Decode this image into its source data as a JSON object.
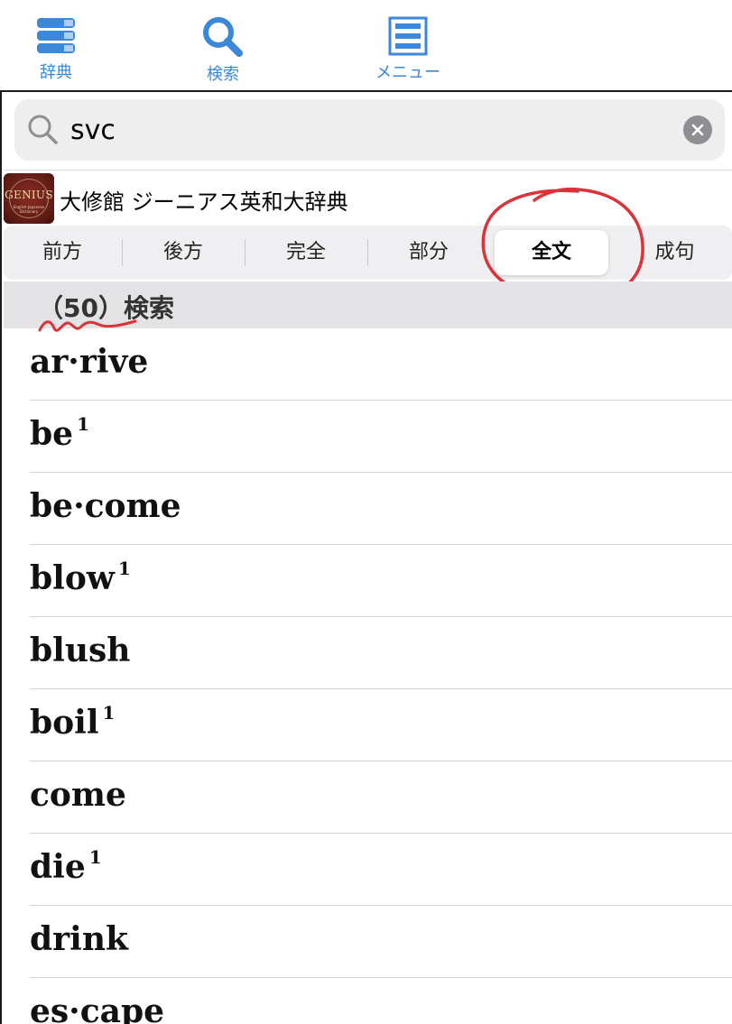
{
  "toolbar": {
    "dict_label": "辞典",
    "search_label": "検索",
    "menu_label": "メニュー"
  },
  "search": {
    "value": "svc"
  },
  "dictionary": {
    "name": "大修館 ジーニアス英和大辞典",
    "logo_text": "GENIUS",
    "logo_sub": "English-Japanese Dictionary"
  },
  "tabs": [
    {
      "label": "前方"
    },
    {
      "label": "後方"
    },
    {
      "label": "完全"
    },
    {
      "label": "部分"
    },
    {
      "label": "全文",
      "selected": true
    },
    {
      "label": "成句"
    }
  ],
  "results": {
    "count_label": "（50）検索",
    "items": [
      {
        "word": "ar·rive",
        "sup": ""
      },
      {
        "word": "be",
        "sup": "1"
      },
      {
        "word": "be·come",
        "sup": ""
      },
      {
        "word": "blow",
        "sup": "1"
      },
      {
        "word": "blush",
        "sup": ""
      },
      {
        "word": "boil",
        "sup": "1"
      },
      {
        "word": "come",
        "sup": ""
      },
      {
        "word": "die",
        "sup": "1"
      },
      {
        "word": "drink",
        "sup": ""
      },
      {
        "word": "es·cape",
        "sup": ""
      }
    ]
  },
  "colors": {
    "accent": "#3b87d9",
    "annotation": "#d9343a"
  }
}
